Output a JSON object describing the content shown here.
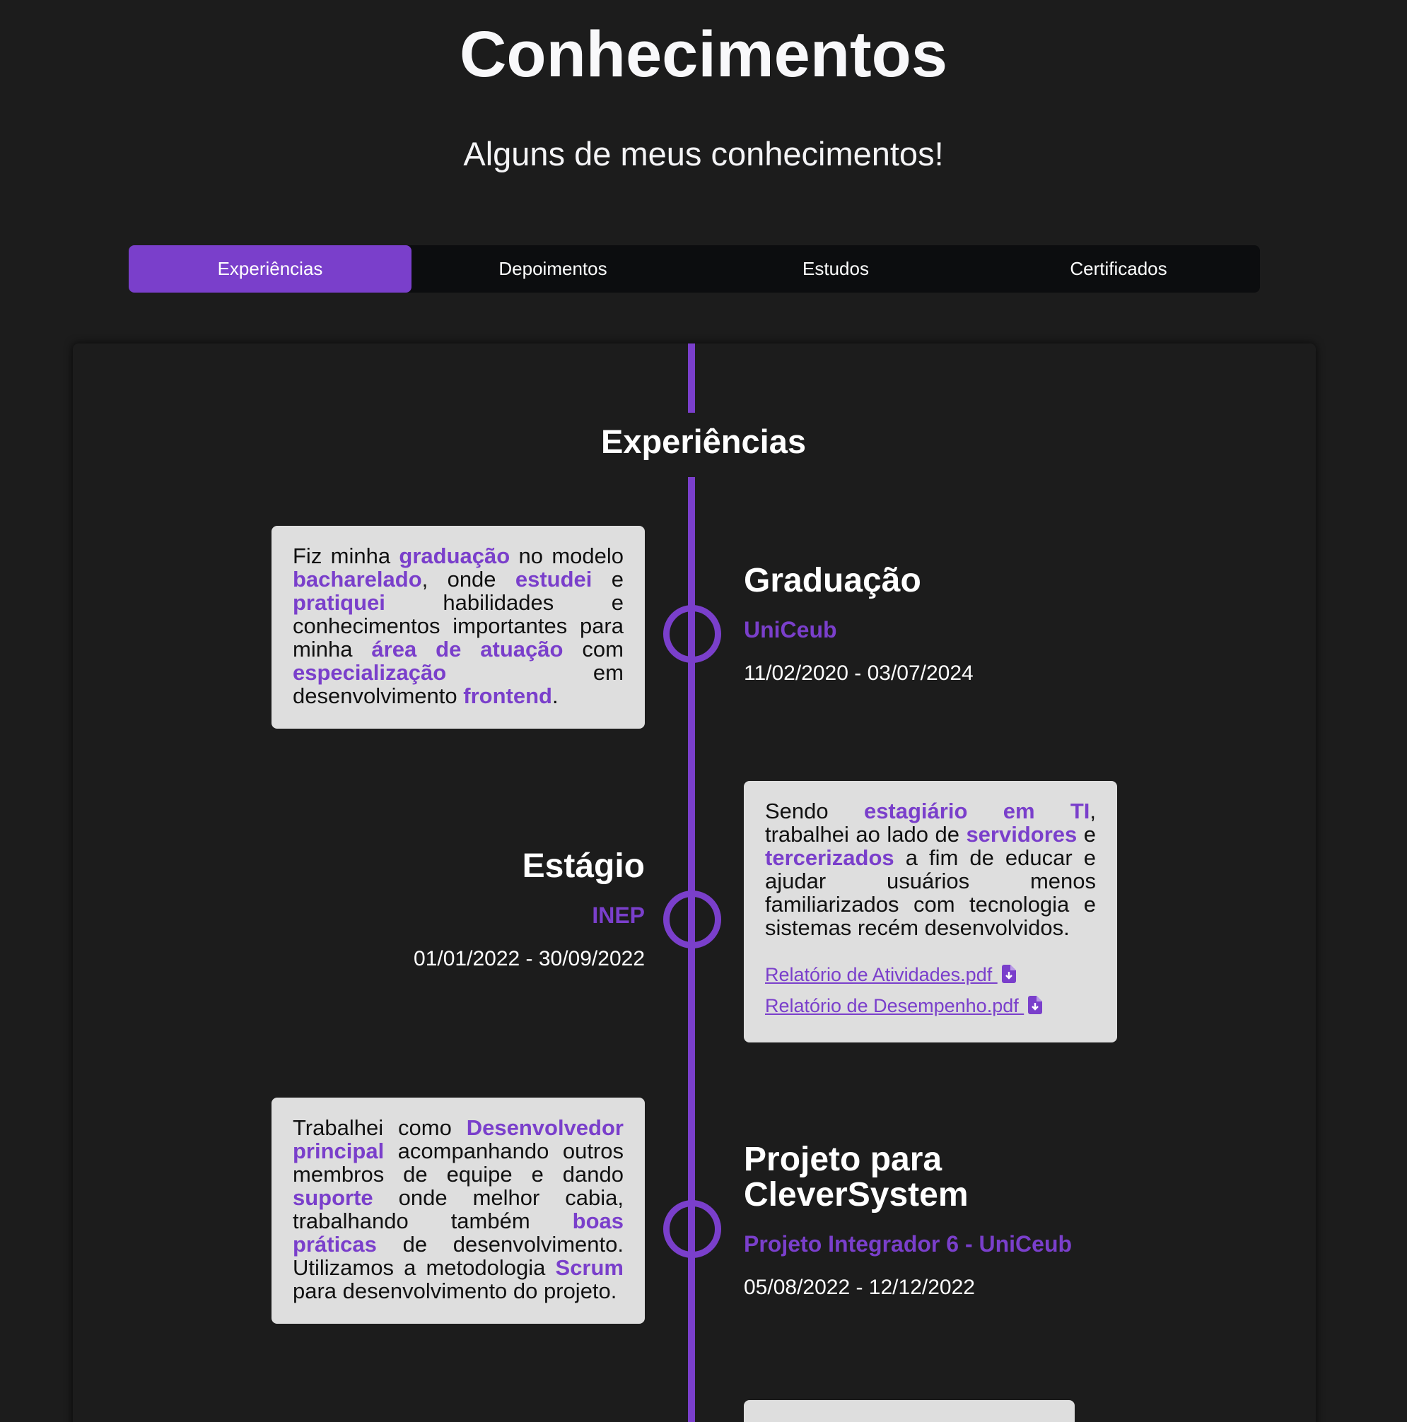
{
  "header": {
    "title": "Conhecimentos",
    "subtitle": "Alguns de meus conhecimentos!"
  },
  "tabs": [
    {
      "label": "Experiências",
      "active": true
    },
    {
      "label": "Depoimentos",
      "active": false
    },
    {
      "label": "Estudos",
      "active": false
    },
    {
      "label": "Certificados",
      "active": false
    }
  ],
  "colors": {
    "accent": "#7a3fcb",
    "background": "#1c1c1c",
    "card": "#dedede",
    "tabbar": "#0c0d0f"
  },
  "timeline": {
    "section_title": "Experiências",
    "entries": [
      {
        "title": "Graduação",
        "org": "UniCeub",
        "dates": "11/02/2020 - 03/07/2024",
        "description": [
          {
            "t": "Fiz minha "
          },
          {
            "t": "graduação",
            "hl": true
          },
          {
            "t": " no modelo "
          },
          {
            "t": "bacharelado",
            "hl": true
          },
          {
            "t": ", onde "
          },
          {
            "t": "estudei",
            "hl": true
          },
          {
            "t": " e "
          },
          {
            "t": "pratiquei",
            "hl": true
          },
          {
            "t": " habilidades e conhecimentos importantes para minha "
          },
          {
            "t": "área de atuação",
            "hl": true
          },
          {
            "t": " com "
          },
          {
            "t": "especialização",
            "hl": true
          },
          {
            "t": " em desenvolvimento "
          },
          {
            "t": "frontend",
            "hl": true
          },
          {
            "t": "."
          }
        ],
        "links": []
      },
      {
        "title": "Estágio",
        "org": "INEP",
        "dates": "01/01/2022 - 30/09/2022",
        "description": [
          {
            "t": "Sendo "
          },
          {
            "t": "estagiário em TI",
            "hl": true
          },
          {
            "t": ", trabalhei ao lado de "
          },
          {
            "t": "servidores",
            "hl": true
          },
          {
            "t": " e "
          },
          {
            "t": "tercerizados",
            "hl": true
          },
          {
            "t": " a fim de educar e ajudar usuários menos familiarizados com tecnologia e sistemas recém desenvolvidos."
          }
        ],
        "links": [
          {
            "label": "Relatório de Atividades.pdf ",
            "icon": "file-download-icon"
          },
          {
            "label": "Relatório de Desempenho.pdf ",
            "icon": "file-download-icon"
          }
        ]
      },
      {
        "title": "Projeto para CleverSystem",
        "org": "Projeto Integrador 6 - UniCeub",
        "dates": "05/08/2022 - 12/12/2022",
        "description": [
          {
            "t": "Trabalhei como "
          },
          {
            "t": "Desenvolvedor principal",
            "hl": true
          },
          {
            "t": " acompanhando outros membros de equipe e dando "
          },
          {
            "t": "suporte",
            "hl": true
          },
          {
            "t": " onde melhor cabia, trabalhando também "
          },
          {
            "t": "boas práticas",
            "hl": true
          },
          {
            "t": " de desenvolvimento. Utilizamos a metodologia "
          },
          {
            "t": "Scrum",
            "hl": true
          },
          {
            "t": " para desenvolvimento do projeto."
          }
        ],
        "links": []
      }
    ]
  }
}
